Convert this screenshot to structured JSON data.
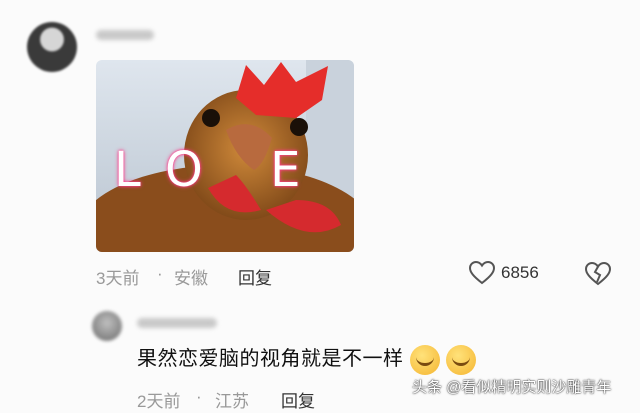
{
  "comment1": {
    "user_name": "",
    "image_text": "LO E",
    "time": "3天前",
    "dot": "·",
    "location": "安徽",
    "reply_label": "回复",
    "like_count": "6856"
  },
  "comment2": {
    "user_name": "",
    "text": "果然恋爱脑的视角就是不一样",
    "time": "2天前",
    "dot": "·",
    "location": "江苏",
    "reply_label": "回复"
  },
  "watermark": {
    "text": "头条 @看似精明实则沙雕青年"
  },
  "icons": [
    "heart-icon",
    "broken-heart-icon",
    "cry-laugh-emoji-icon"
  ],
  "colors": {
    "meta": "#999999",
    "text": "#111111"
  }
}
